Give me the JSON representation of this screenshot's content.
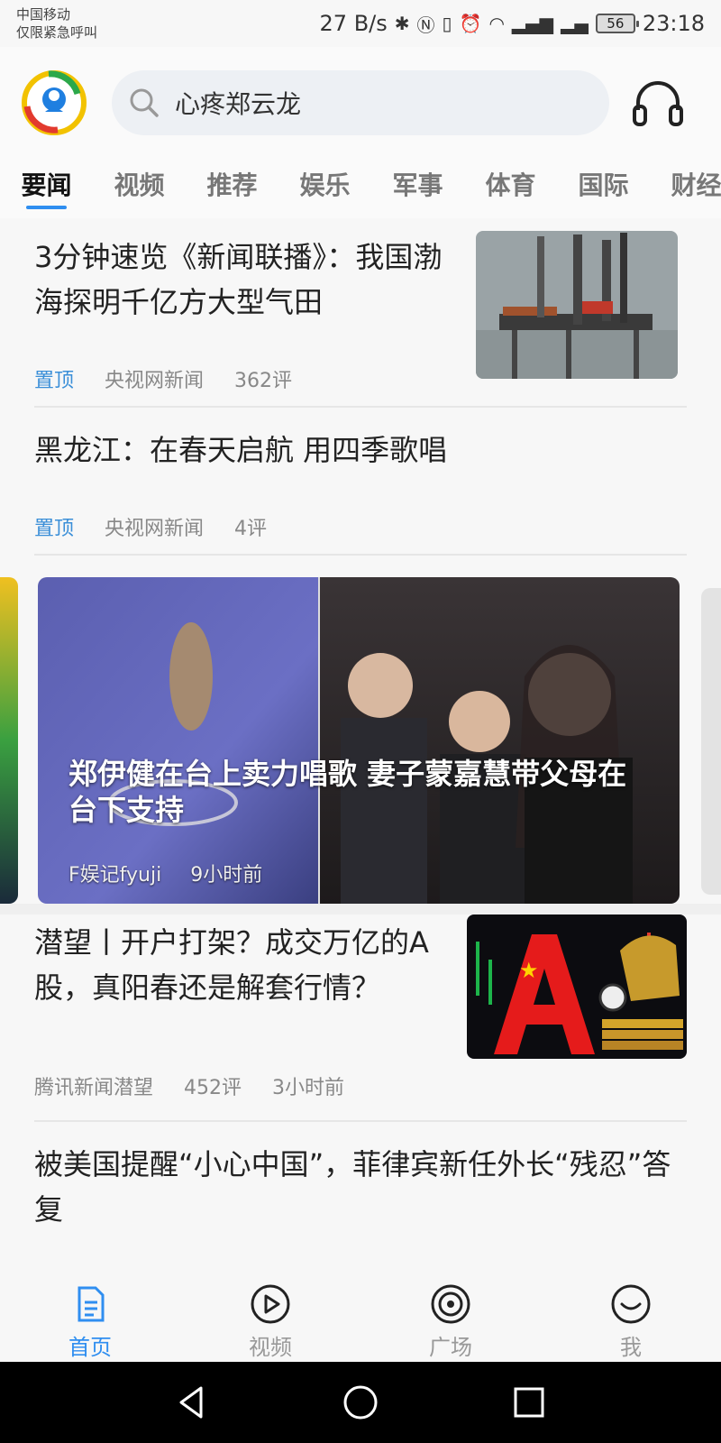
{
  "status_bar": {
    "carrier_line1": "中国移动",
    "carrier_line2": "仅限紧急呼叫",
    "net_speed": "27 B/s",
    "battery": "56",
    "time": "23:18"
  },
  "header": {
    "search_text": "心疼郑云龙",
    "tabs": [
      "要闻",
      "视频",
      "推荐",
      "娱乐",
      "军事",
      "体育",
      "国际",
      "财经"
    ],
    "active_tab": 0
  },
  "feed": {
    "item1": {
      "title": "3分钟速览《新闻联播》：我国渤海探明千亿方大型气田",
      "pin": "置顶",
      "source": "央视网新闻",
      "comments": "362评"
    },
    "item2": {
      "title": "黑龙江：在春天启航 用四季歌唱",
      "pin": "置顶",
      "source": "央视网新闻",
      "comments": "4评"
    },
    "banner": {
      "title": "郑伊健在台上卖力唱歌 妻子蒙嘉慧带父母在台下支持",
      "source": "F娱记fyuji",
      "time": "9小时前"
    },
    "item3": {
      "title": "潜望丨开户打架？成交万亿的A股，真阳春还是解套行情？",
      "source": "腾讯新闻潜望",
      "comments": "452评",
      "time": "3小时前"
    },
    "item4": {
      "title": "被美国提醒“小心中国”，菲律宾新任外长“残忍”答复"
    }
  },
  "bottom_nav": {
    "home": "首页",
    "video": "视频",
    "plaza": "广场",
    "me": "我"
  },
  "colors": {
    "accent": "#2f8ef0",
    "pin": "#3b8fd8"
  },
  "icons": {
    "search": "search-icon",
    "headphones": "headphone-icon",
    "home": "home-icon",
    "play": "play-icon",
    "plaza": "plaza-icon",
    "me": "smile-icon"
  }
}
